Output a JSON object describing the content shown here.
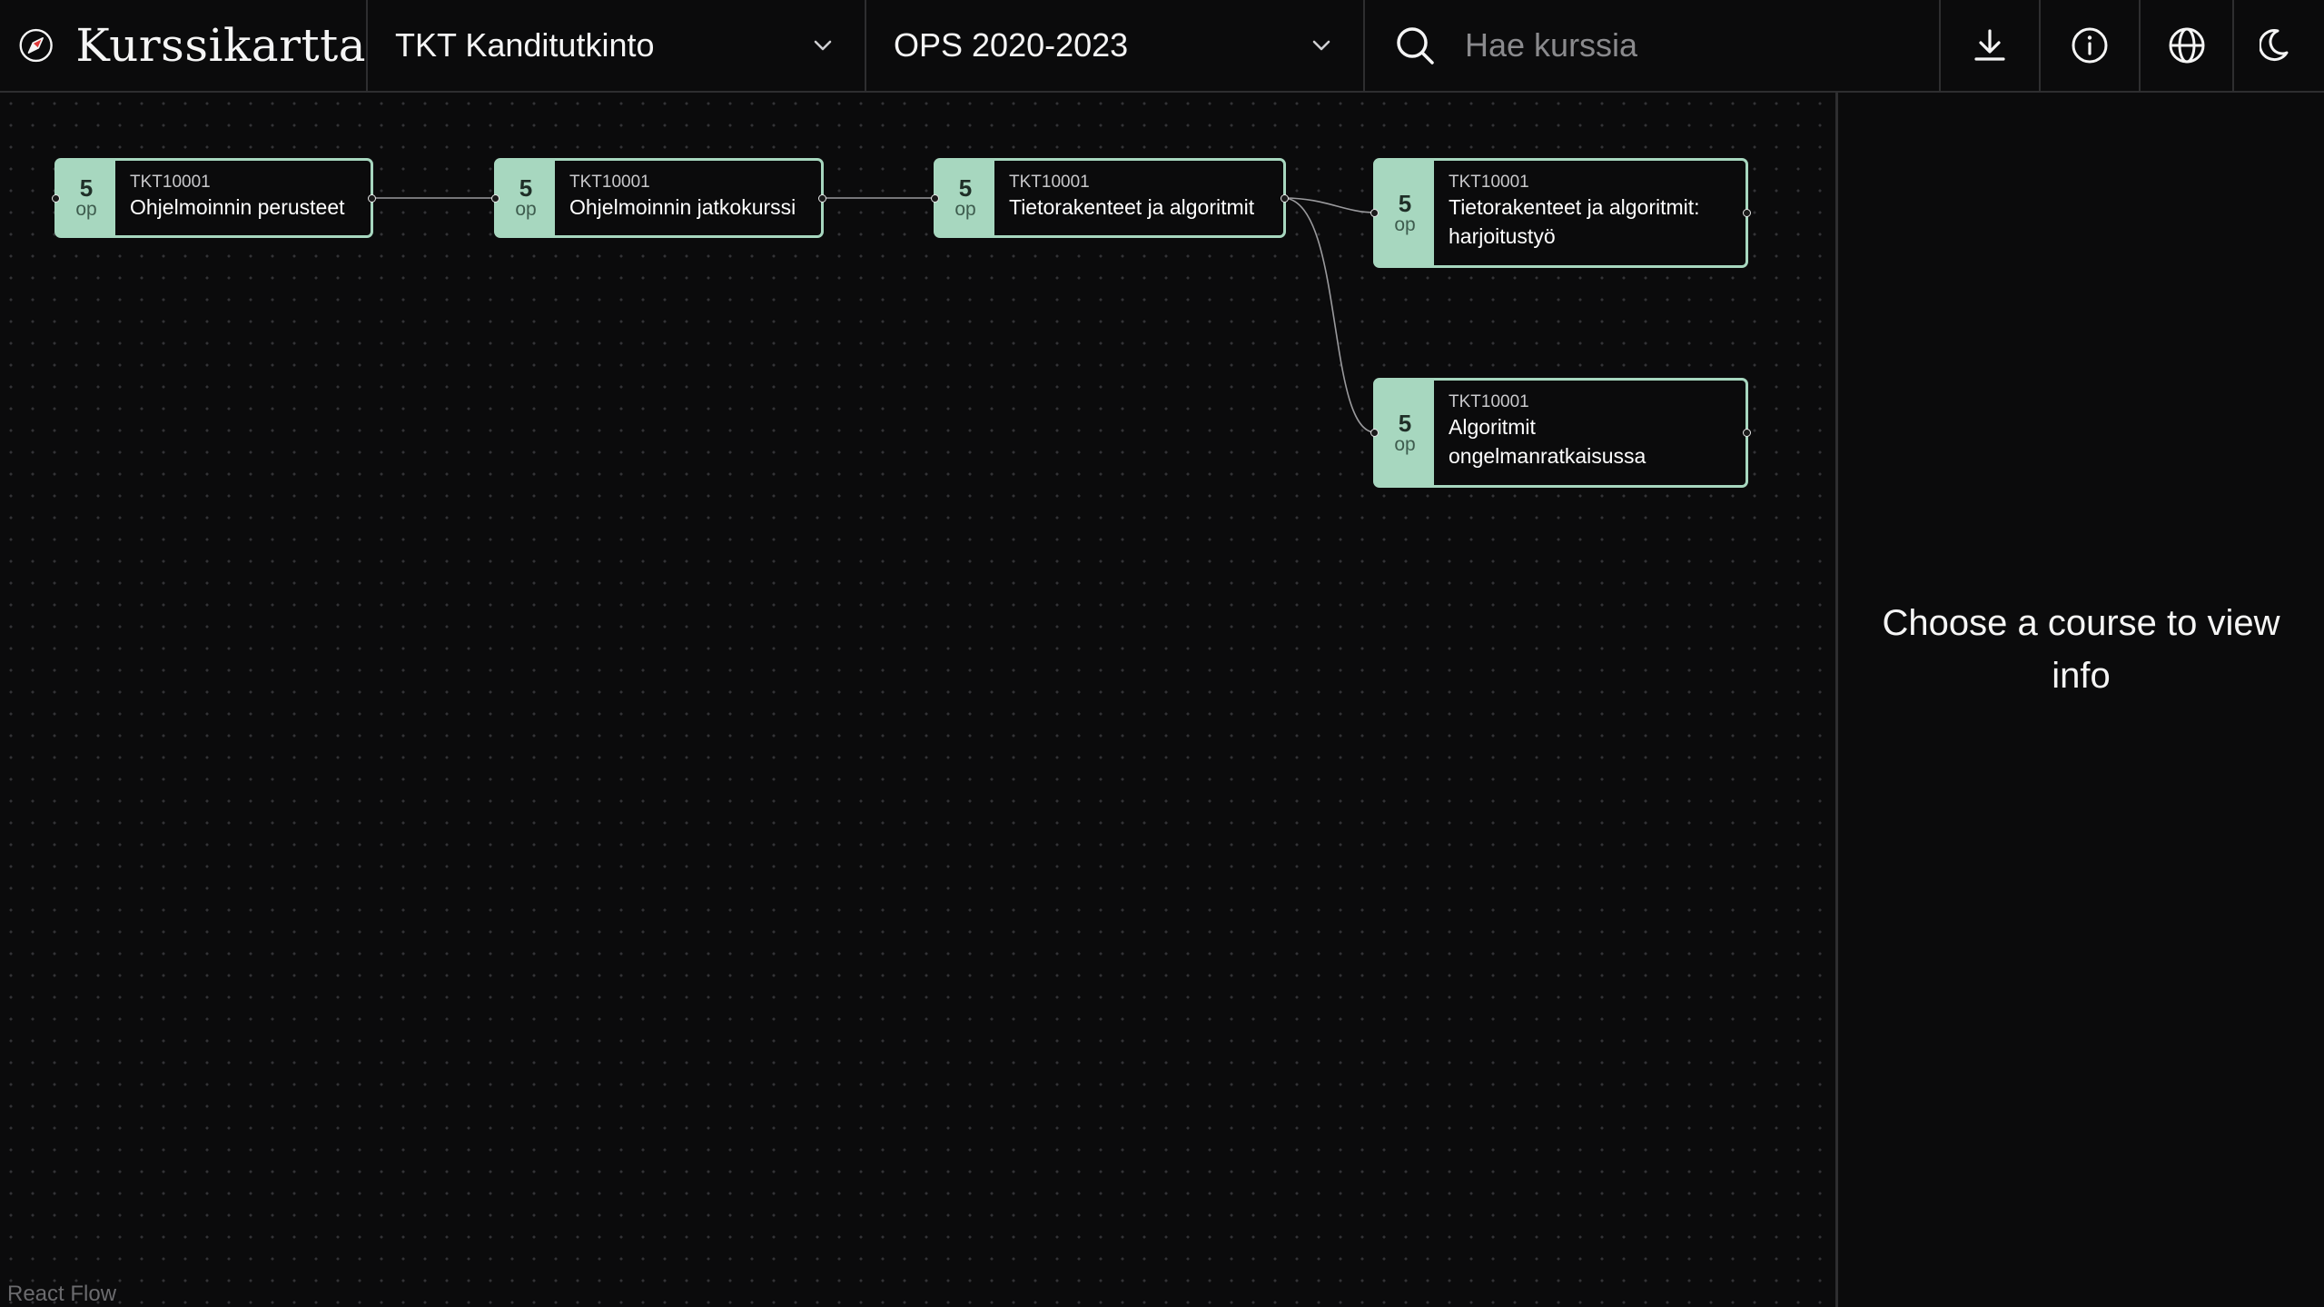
{
  "header": {
    "title": "Kurssikartta",
    "degree_select": {
      "selected": "TKT Kanditutkinto"
    },
    "curriculum_select": {
      "selected": "OPS 2020-2023"
    },
    "search": {
      "placeholder": "Hae kurssia",
      "value": ""
    },
    "icons": [
      "compass-logo",
      "chevron-down-icon",
      "search-icon",
      "download-icon",
      "info-icon",
      "globe-icon",
      "moon-icon"
    ]
  },
  "colors": {
    "background": "#0b0b0c",
    "node_accent": "#a7d7bf",
    "border": "#2e2e30"
  },
  "courses": [
    {
      "id": "c1",
      "credits": "5",
      "unit": "op",
      "code": "TKT10001",
      "name_lines": [
        "Ohjelmoinnin perusteet"
      ]
    },
    {
      "id": "c2",
      "credits": "5",
      "unit": "op",
      "code": "TKT10001",
      "name_lines": [
        "Ohjelmoinnin jatkokurssi"
      ]
    },
    {
      "id": "c3",
      "credits": "5",
      "unit": "op",
      "code": "TKT10001",
      "name_lines": [
        "Tietorakenteet ja algoritmit"
      ]
    },
    {
      "id": "c4",
      "credits": "5",
      "unit": "op",
      "code": "TKT10001",
      "name_lines": [
        "Tietorakenteet ja algoritmit:",
        "harjoitustyö"
      ]
    },
    {
      "id": "c5",
      "credits": "5",
      "unit": "op",
      "code": "TKT10001",
      "name_lines": [
        "Algoritmit",
        "ongelmanratkaisussa"
      ]
    }
  ],
  "edges": [
    {
      "from": "c1",
      "to": "c2"
    },
    {
      "from": "c2",
      "to": "c3"
    },
    {
      "from": "c3",
      "to": "c4"
    },
    {
      "from": "c3",
      "to": "c5"
    }
  ],
  "canvas": {
    "watermark": "React Flow"
  },
  "info_panel": {
    "message": "Choose a course to view info"
  }
}
